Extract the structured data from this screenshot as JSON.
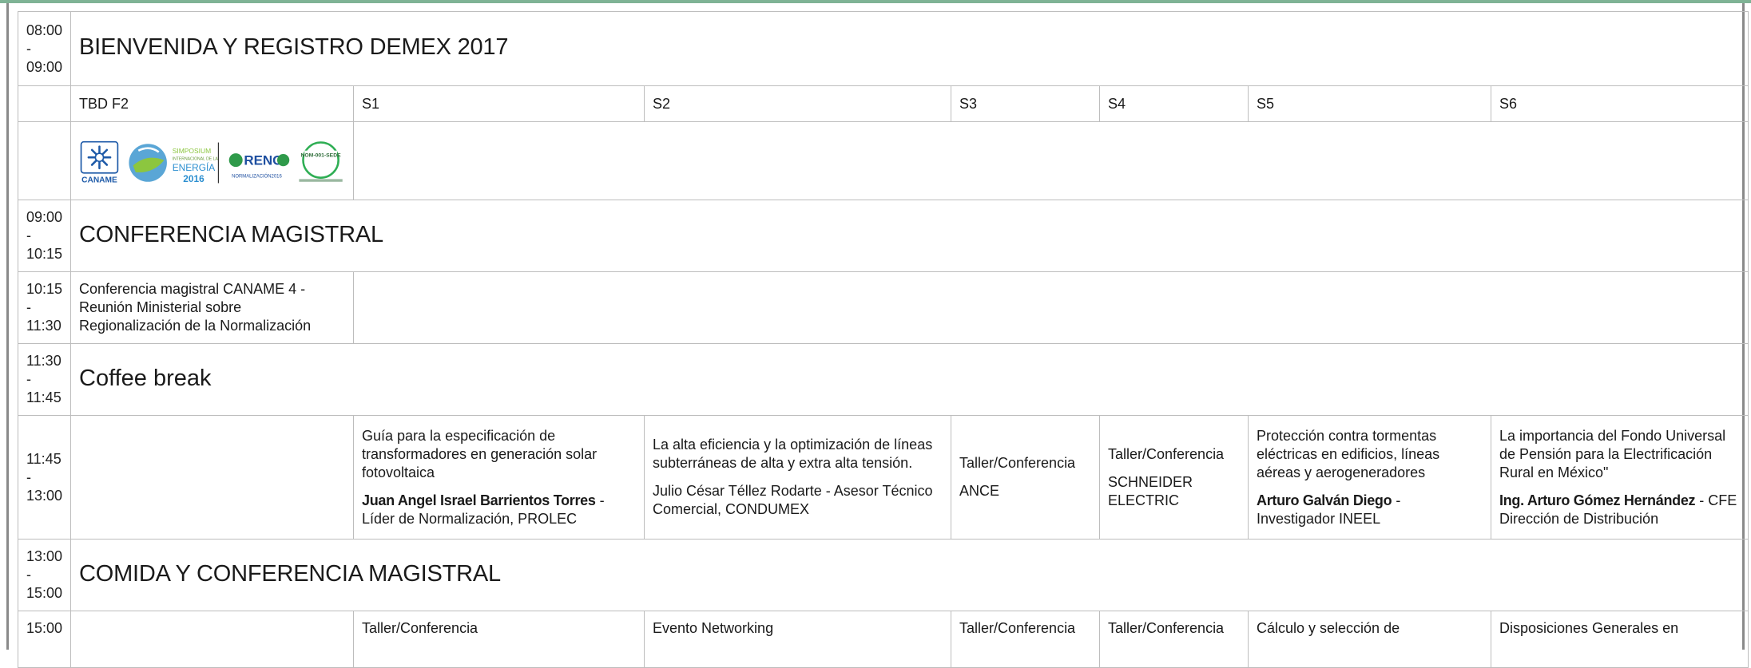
{
  "time_sep": "-",
  "rows": {
    "welcome": {
      "start": "08:00",
      "end": "09:00",
      "title": "BIENVENIDA Y REGISTRO DEMEX 2017"
    },
    "rooms": [
      "TBD F2",
      "S1",
      "S2",
      "S3",
      "S4",
      "S5",
      "S6"
    ],
    "logos": {
      "caname": "CANAME",
      "simposium": [
        "SIMPOSIUM",
        "INTERNACIONAL DE LA",
        "ENERGÍA",
        "2016"
      ],
      "reno": [
        "RENO",
        "NORMALIZACIÓN2016"
      ],
      "nom": [
        "NOM-001-SEDE"
      ]
    },
    "conference": {
      "start": "09:00",
      "end": "10:15",
      "title": "CONFERENCIA MAGISTRAL"
    },
    "ministerial": {
      "start": "10:15",
      "end": "11:30",
      "text": "Conferencia magistral CANAME 4 - Reunión Ministerial sobre Regionalización de la Normalización"
    },
    "coffee": {
      "start": "11:30",
      "end": "11:45",
      "title": "Coffee break"
    },
    "sessions": {
      "start": "11:45",
      "end": "13:00",
      "s1": {
        "title": "Guía para la especificación de transformadores en generación solar fotovoltaica",
        "speaker": "Juan Angel Israel Barrientos Torres",
        "role": " - Líder de Normalización, PROLEC"
      },
      "s2": {
        "title": "La alta eficiencia y la optimización de líneas subterráneas de alta y extra alta tensión.",
        "speaker_plain": "Julio César Téllez Rodarte - Asesor Técnico Comercial, CONDUMEX"
      },
      "s3": {
        "title": "Taller/Conferencia",
        "org": "ANCE"
      },
      "s4": {
        "title": "Taller/Conferencia",
        "org": "SCHNEIDER ELECTRIC"
      },
      "s5": {
        "title": "Protección contra tormentas eléctricas en edificios, líneas aéreas y aerogeneradores",
        "speaker": "Arturo Galván Diego",
        "role": " - Investigador INEEL"
      },
      "s6": {
        "title": "La importancia del Fondo Universal de Pensión para la Electrificación Rural en México\"",
        "speaker": "Ing. Arturo Gómez Hernández",
        "role": " - CFE Dirección de Distribución"
      }
    },
    "lunch": {
      "start": "13:00",
      "end": "15:00",
      "title": "COMIDA Y CONFERENCIA MAGISTRAL"
    },
    "afternoon": {
      "start": "15:00",
      "s1": "Taller/Conferencia",
      "s2": "Evento Networking",
      "s3": "Taller/Conferencia",
      "s4": "Taller/Conferencia",
      "s5": "Cálculo y selección de",
      "s6": "Disposiciones Generales en"
    }
  }
}
